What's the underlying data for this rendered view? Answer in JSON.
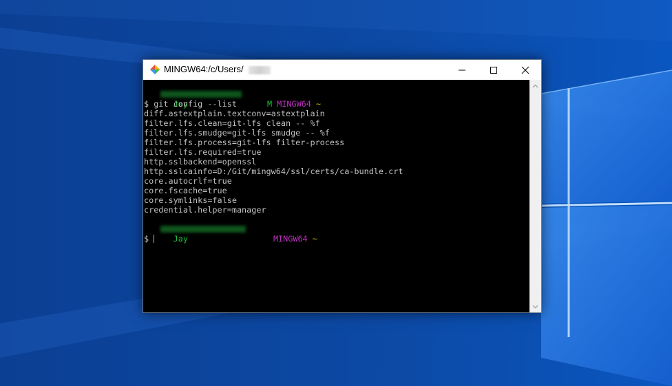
{
  "window": {
    "title": "MINGW64:/c/Users/"
  },
  "terminal": {
    "prompt1": {
      "user": "Jay",
      "suffix": "M",
      "env": "MINGW64",
      "path": "~"
    },
    "command": "$ git config --list",
    "output": [
      "diff.astextplain.textconv=astextplain",
      "filter.lfs.clean=git-lfs clean -- %f",
      "filter.lfs.smudge=git-lfs smudge -- %f",
      "filter.lfs.process=git-lfs filter-process",
      "filter.lfs.required=true",
      "http.sslbackend=openssl",
      "http.sslcainfo=D:/Git/mingw64/ssl/certs/ca-bundle.crt",
      "core.autocrlf=true",
      "core.fscache=true",
      "core.symlinks=false",
      "credential.helper=manager"
    ],
    "prompt2": {
      "user": "Jay",
      "env": "MINGW64",
      "path": "~"
    },
    "input_prefix": "$ "
  },
  "colors": {
    "desktop_blue": "#0d4aa8",
    "user_green": "#1fbd3a",
    "env_magenta": "#c030c0",
    "path_yellow": "#c8c800",
    "terminal_text": "#c0c0c0"
  }
}
